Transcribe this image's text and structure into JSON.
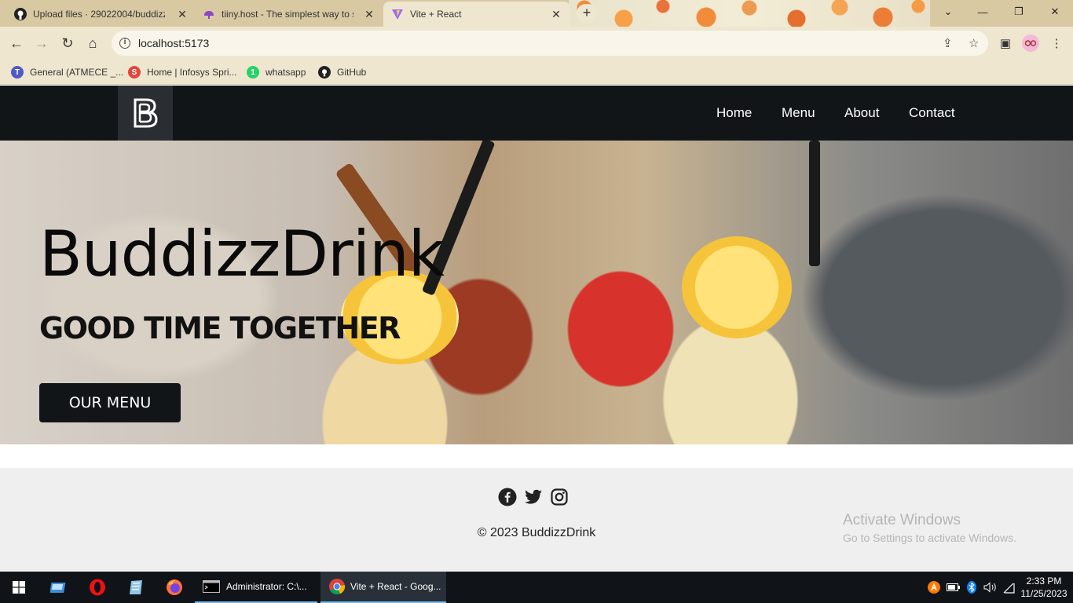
{
  "browser": {
    "tabs": [
      {
        "title": "Upload files · 29022004/buddizz",
        "icon": "github-icon",
        "close": "✕"
      },
      {
        "title": "tiiny.host - The simplest way to s",
        "icon": "tiiny-host-icon",
        "close": "✕"
      },
      {
        "title": "Vite + React",
        "icon": "vite-icon",
        "close": "✕",
        "active": true
      }
    ],
    "new_tab": "+",
    "url": "localhost:5173",
    "bookmarks": [
      {
        "label": "General (ATMECE _...",
        "icon": "teams-icon",
        "color": "#5059c9"
      },
      {
        "label": "Home | Infosys Spri...",
        "icon": "infosys-icon",
        "color": "#e2473b"
      },
      {
        "label": "whatsapp",
        "icon": "whatsapp-icon",
        "color": "#25d366"
      },
      {
        "label": "GitHub",
        "icon": "github-icon",
        "color": "#222222"
      }
    ]
  },
  "site": {
    "nav": [
      {
        "label": "Home"
      },
      {
        "label": "Menu"
      },
      {
        "label": "About"
      },
      {
        "label": "Contact"
      }
    ],
    "hero": {
      "title": "BuddizzDrink",
      "subtitle": "GOOD TIME TOGETHER",
      "button": "OUR MENU"
    },
    "footer": {
      "socials": [
        "facebook-icon",
        "twitter-icon",
        "instagram-icon"
      ],
      "copyright": "© 2023 BuddizzDrink"
    },
    "colors": {
      "header_bg": "#121518",
      "button_bg": "#121518",
      "footer_bg": "#efefef"
    }
  },
  "watermark": {
    "title": "Activate Windows",
    "subtitle": "Go to Settings to activate Windows."
  },
  "taskbar": {
    "tasks": [
      {
        "label": "Administrator:  C:\\..."
      },
      {
        "label": "Vite + React - Goog..."
      }
    ],
    "time": "2:33 PM",
    "date": "11/25/2023"
  }
}
